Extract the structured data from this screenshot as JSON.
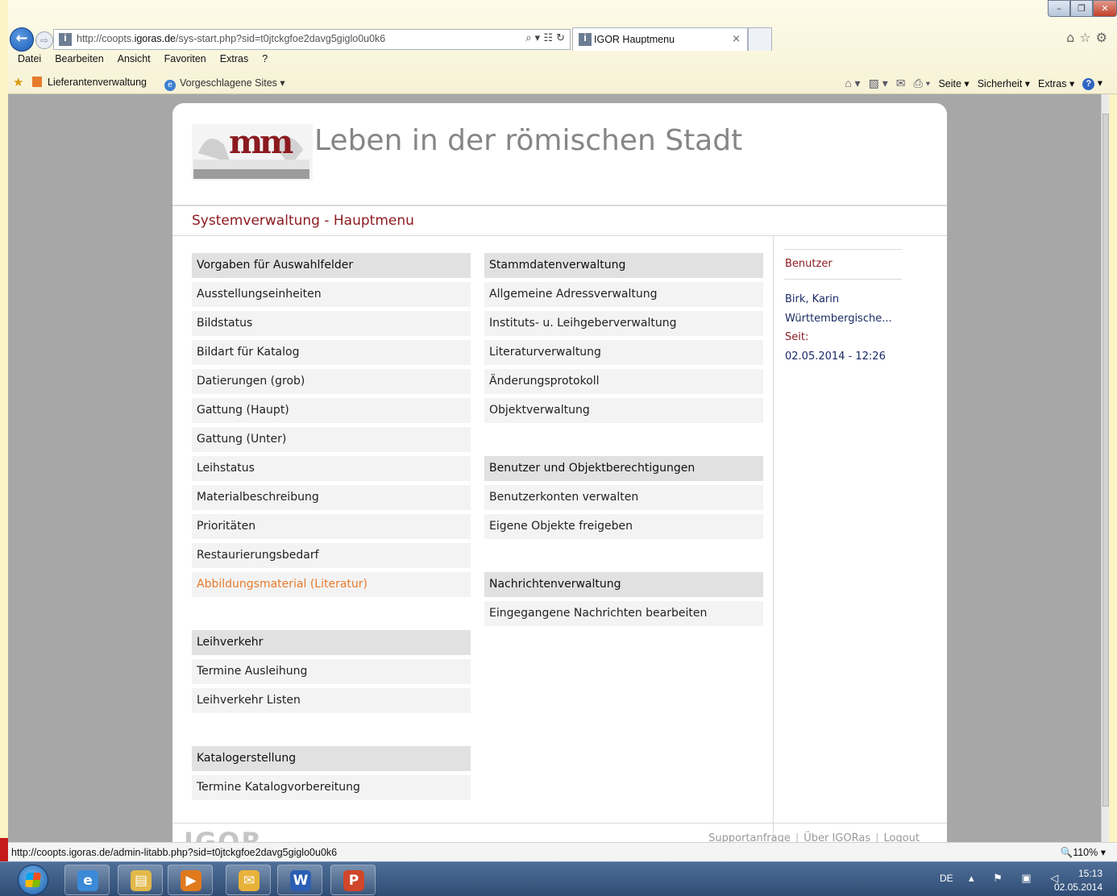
{
  "browser": {
    "address_prefix": "http://coopts.",
    "address_domain": "igoras.de",
    "address_suffix": "/sys-start.php?sid=t0jtckgfoe2davg5giglo0u0k6",
    "addr_tools": "⌕ ▾ ☷ ↻",
    "tab_title": "IGOR Hauptmenu",
    "tab_close": "×",
    "back_icon": "←",
    "forward_icon": "⇨",
    "site_icon": "İ",
    "win_min": "–",
    "win_max": "❐",
    "win_close": "✕",
    "right_icons": "⌂☆⚙"
  },
  "menubar": [
    "Datei",
    "Bearbeiten",
    "Ansicht",
    "Favoriten",
    "Extras",
    "?"
  ],
  "favorites": {
    "link1": "Lieferantenverwaltung",
    "link2": "Vorgeschlagene Sites ▾",
    "ie_icon": "e",
    "star_icon": "★"
  },
  "commandbar": {
    "home": "⌂ ▾",
    "feeds": "▧ ▾",
    "mail": "✉",
    "print": "⎙ ▾",
    "page": "Seite ▾",
    "safety": "Sicherheit ▾",
    "tools": "Extras ▾",
    "help": "?",
    "help_arrow": "▾"
  },
  "page": {
    "title": "Leben in der römischen Stadt",
    "section_title": "Systemverwaltung - Hauptmenu",
    "left_groups": [
      {
        "header": "Vorgaben für Auswahlfelder",
        "items": [
          "Ausstellungseinheiten",
          "Bildstatus",
          "Bildart für Katalog",
          "Datierungen (grob)",
          "Gattung (Haupt)",
          "Gattung (Unter)",
          "Leihstatus",
          "Materialbeschreibung",
          "Prioritäten",
          "Restaurierungsbedarf",
          "Abbildungsmaterial (Literatur)"
        ]
      },
      {
        "header": "Leihverkehr",
        "items": [
          "Termine Ausleihung",
          "Leihverkehr Listen"
        ]
      },
      {
        "header": "Katalogerstellung",
        "items": [
          "Termine Katalogvorbereitung"
        ]
      }
    ],
    "right_groups": [
      {
        "header": "Stammdatenverwaltung",
        "items": [
          "Allgemeine Adressverwaltung",
          "Instituts- u. Leihgeberverwaltung",
          "Literaturverwaltung",
          "Änderungsprotokoll",
          "Objektverwaltung"
        ]
      },
      {
        "header": "Benutzer und Objektberechtigungen",
        "items": [
          "Benutzerkonten verwalten",
          "Eigene Objekte freigeben"
        ]
      },
      {
        "header": "Nachrichtenverwaltung",
        "items": [
          "Eingegangene Nachrichten bearbeiten"
        ]
      }
    ],
    "user_panel": {
      "heading": "Benutzer",
      "name": "Birk, Karin",
      "institution": "Württembergische...",
      "since_label": "Seit:",
      "since_value": "02.05.2014 - 12:26"
    },
    "footer": {
      "logo_text": "IGOR",
      "links": [
        "Supportanfrage",
        "Über IGORas",
        "Logout"
      ]
    }
  },
  "statusbar": {
    "url": "http://coopts.igoras.de/admin-litabb.php?sid=t0jtckgfoe2davg5giglo0u0k6",
    "zoom": "🔍110%  ▾"
  },
  "taskbar": {
    "apps": [
      {
        "name": "internet-explorer",
        "glyph": "e",
        "color": "#3b8ad8"
      },
      {
        "name": "file-explorer",
        "glyph": "▤",
        "color": "#e2b94a"
      },
      {
        "name": "media-player",
        "glyph": "▶",
        "color": "#e07a1d"
      },
      {
        "name": "outlook",
        "glyph": "✉",
        "color": "#e8b23a"
      },
      {
        "name": "word",
        "glyph": "W",
        "color": "#2b5fb4"
      },
      {
        "name": "powerpoint",
        "glyph": "P",
        "color": "#d0462a"
      }
    ],
    "lang": "DE",
    "tray_icons": "▴ ⚑ ▣ ◁",
    "time": "15:13",
    "date": "02.05.2014"
  }
}
